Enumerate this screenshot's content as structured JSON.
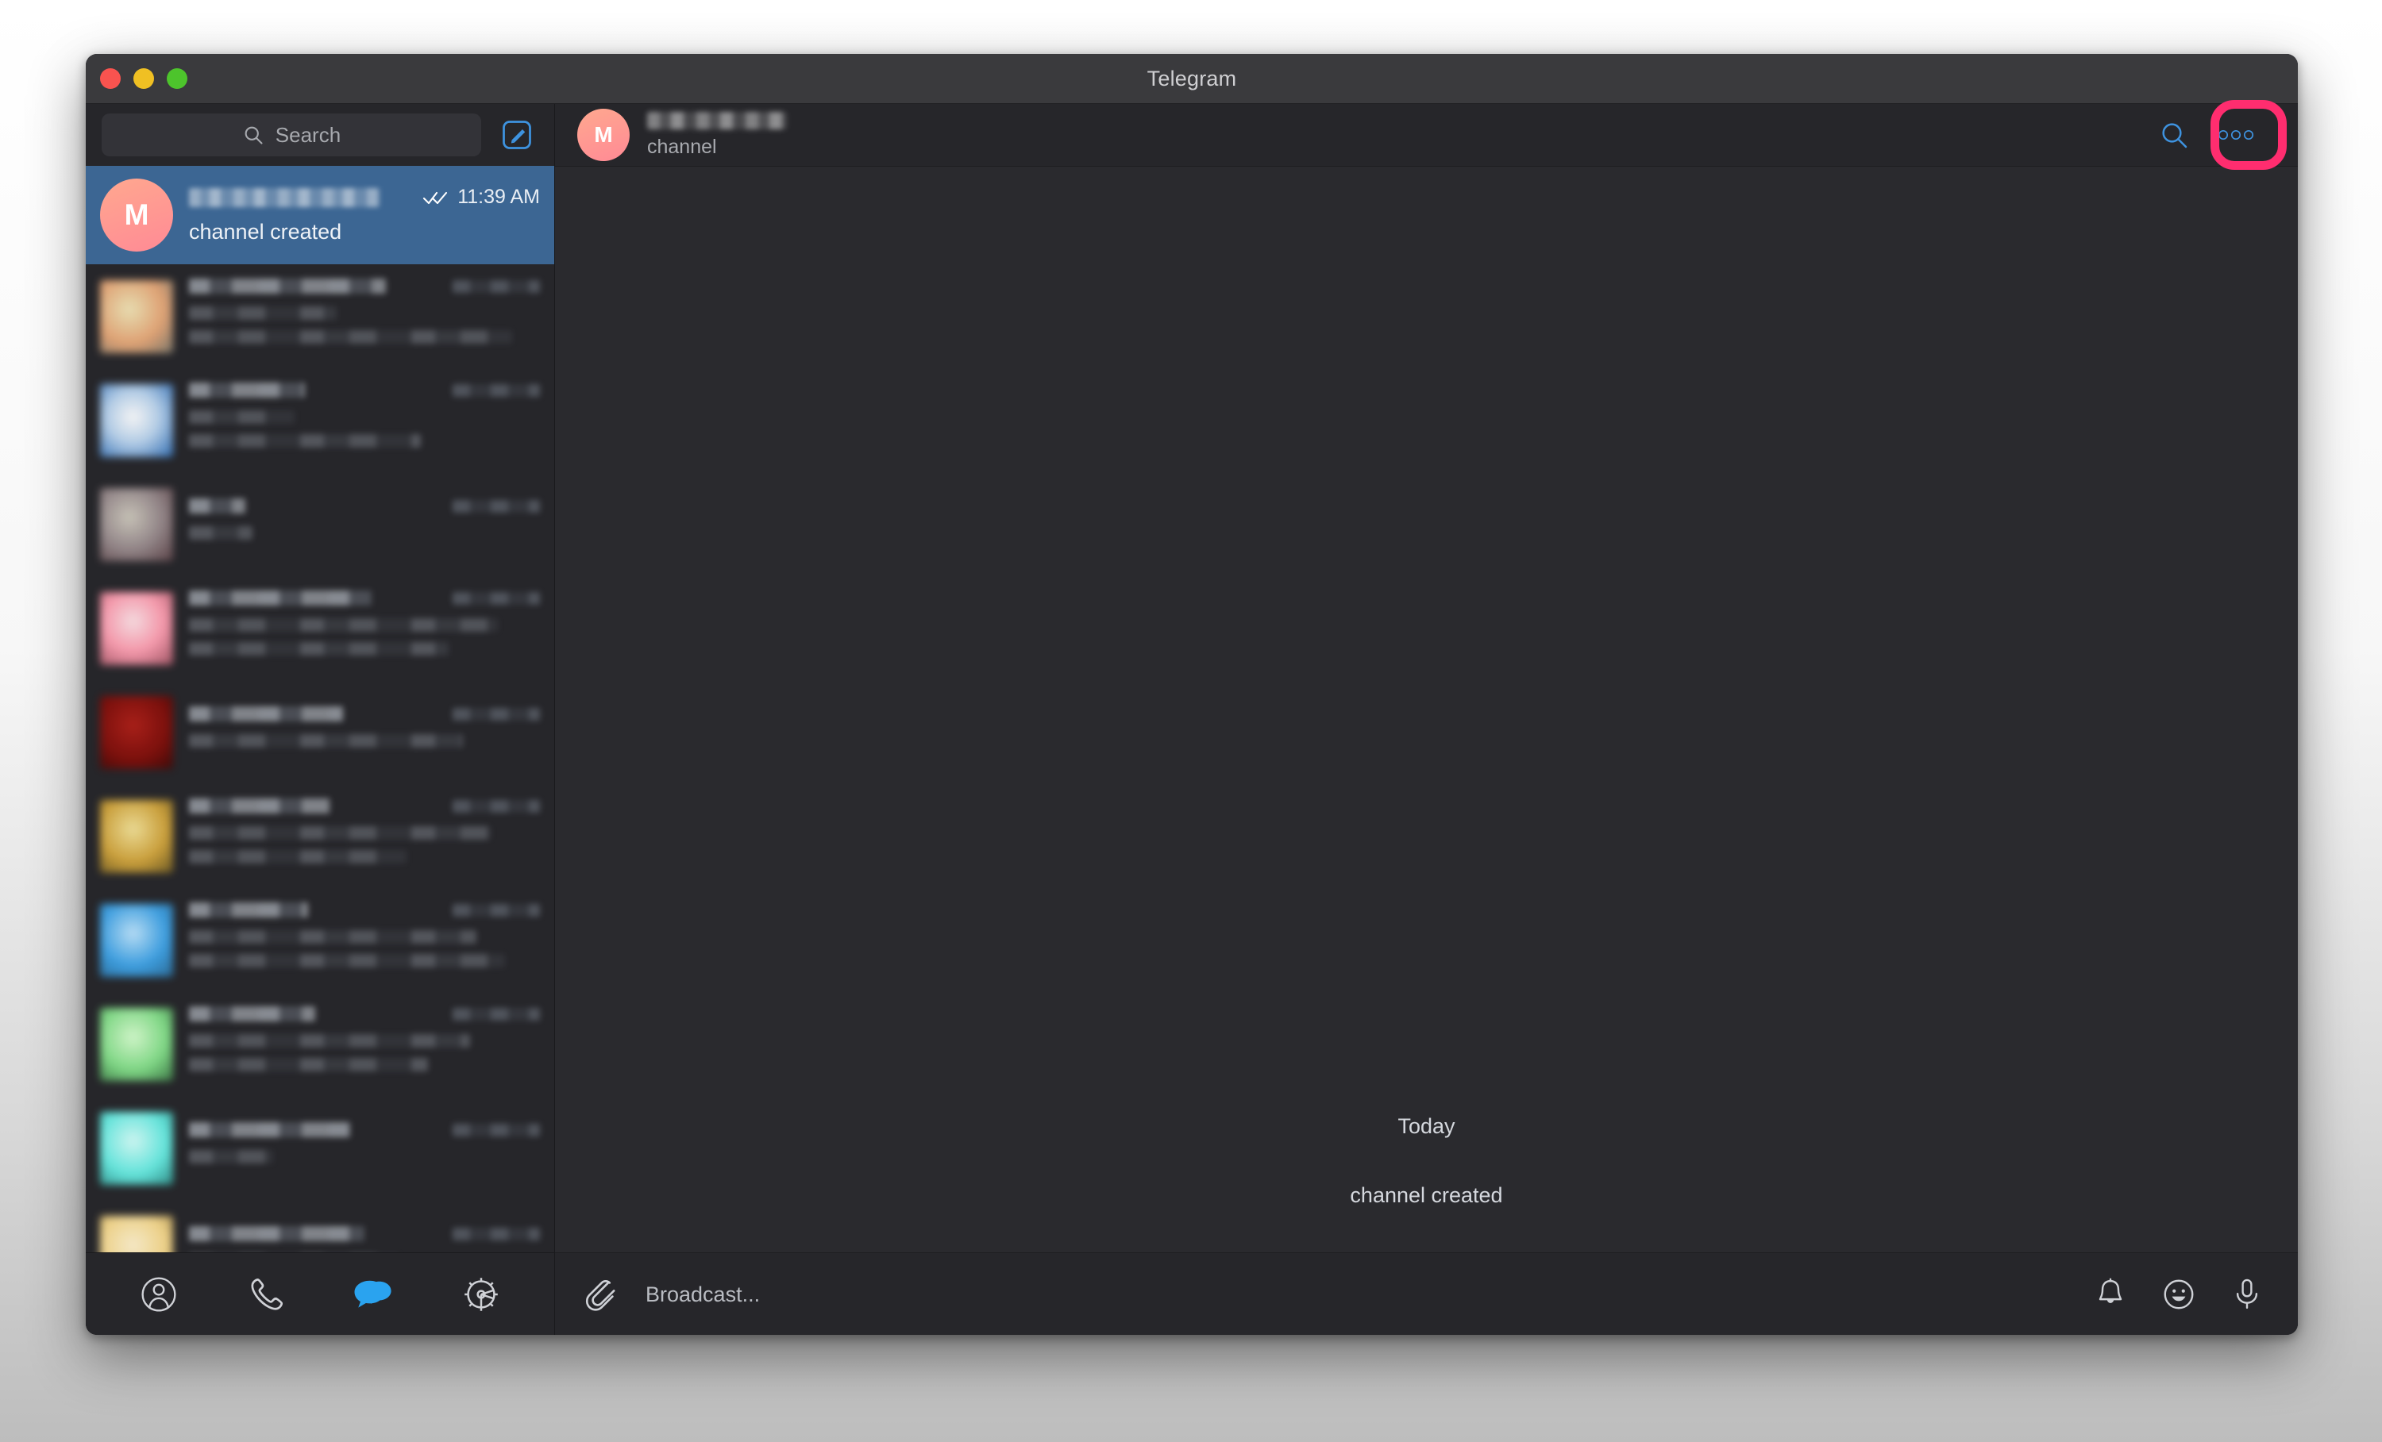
{
  "window": {
    "title": "Telegram",
    "traffic_lights": [
      {
        "name": "close",
        "color": "#f9534f"
      },
      {
        "name": "minimize",
        "color": "#f0c023"
      },
      {
        "name": "zoom",
        "color": "#4dc42c"
      }
    ]
  },
  "sidebar": {
    "search": {
      "placeholder": "Search",
      "icon": "search-icon"
    },
    "compose": {
      "icon": "compose-pencil-icon"
    },
    "selected_chat": {
      "avatar_letter": "M",
      "avatar_color": "#ff8a95",
      "name_redacted": true,
      "preview": "channel created",
      "time": "11:39 AM",
      "read_status_icon": "double-check-icon"
    },
    "blurred_rows": [
      {
        "avatar_color": "#e3c89a"
      },
      {
        "avatar_color": "#cfe0f5"
      },
      {
        "avatar_color": "#8a7f86"
      },
      {
        "avatar_color": "#ffa8b6"
      },
      {
        "avatar_color": "#8e1410"
      },
      {
        "avatar_color": "#d6b33f"
      },
      {
        "avatar_color": "#4db0ee"
      },
      {
        "avatar_color": "#96e79a"
      },
      {
        "avatar_color": "#7ef0ea"
      },
      {
        "avatar_color": "#fbe4a6"
      }
    ],
    "tabs": [
      {
        "name": "contacts",
        "icon": "contacts-person-icon",
        "active": false
      },
      {
        "name": "calls",
        "icon": "phone-icon",
        "active": false
      },
      {
        "name": "chats",
        "icon": "chat-bubbles-icon",
        "active": true
      },
      {
        "name": "settings",
        "icon": "gear-icon",
        "active": false
      }
    ]
  },
  "chat": {
    "header": {
      "avatar_letter": "M",
      "avatar_color": "#ff8a95",
      "name_redacted": true,
      "subtitle": "channel",
      "search_icon": "search-icon",
      "menu_icon": "more-options-icon",
      "menu_highlight_color": "#ff2d6f"
    },
    "messages": [
      {
        "type": "date-separator",
        "text": "Today"
      },
      {
        "type": "service",
        "text": "channel created"
      }
    ],
    "composer": {
      "attach_icon": "paperclip-icon",
      "placeholder": "Broadcast...",
      "actions": [
        {
          "name": "notifications",
          "icon": "bell-icon"
        },
        {
          "name": "emoji",
          "icon": "smiley-icon"
        },
        {
          "name": "voice",
          "icon": "microphone-icon"
        }
      ]
    }
  },
  "colors": {
    "selected_row": "#3c6693",
    "accent_blue": "#4aa3e8",
    "window_bg": "#2a2a2e",
    "sidebar_bg": "#26262a",
    "titlebar_bg": "#3a3a3d",
    "highlight_pink": "#ff2d6f"
  }
}
